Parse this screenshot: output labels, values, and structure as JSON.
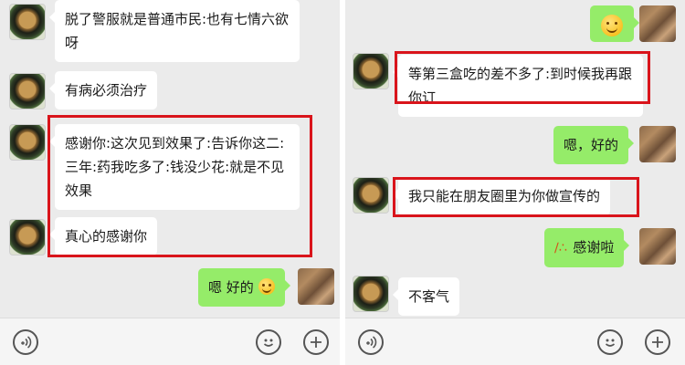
{
  "left_chat": {
    "messages": [
      {
        "side": "in",
        "text": "脱了警服就是普通市民:也有七情六欲呀"
      },
      {
        "side": "in",
        "text": "有病必须治疗"
      },
      {
        "side": "in",
        "text": "感谢你:这次见到效果了:告诉你这二:三年:药我吃多了:钱没少花:就是不见效果"
      },
      {
        "side": "in",
        "text": "真心的感谢你"
      },
      {
        "side": "out",
        "text": "嗯 好的",
        "emoji": "smile-emoji"
      }
    ]
  },
  "right_chat": {
    "messages": [
      {
        "side": "out",
        "text": "",
        "emoji": "smile-emoji"
      },
      {
        "side": "in",
        "text": "等第三盒吃的差不多了:到时候我再跟你订"
      },
      {
        "side": "out",
        "text": "嗯，好的"
      },
      {
        "side": "in",
        "text": "我只能在朋友圈里为你做宣传的"
      },
      {
        "side": "out",
        "text": "感谢啦",
        "emoji": "party-popper-emoji"
      },
      {
        "side": "in",
        "text": "不客气"
      }
    ]
  },
  "colors": {
    "chat_background": "#ebebeb",
    "incoming_bubble": "#ffffff",
    "outgoing_bubble": "#95ec69",
    "highlight_box": "#d9141b"
  },
  "toolbar": {
    "icons": [
      "voice-icon",
      "emoji-icon",
      "plus-icon"
    ]
  }
}
